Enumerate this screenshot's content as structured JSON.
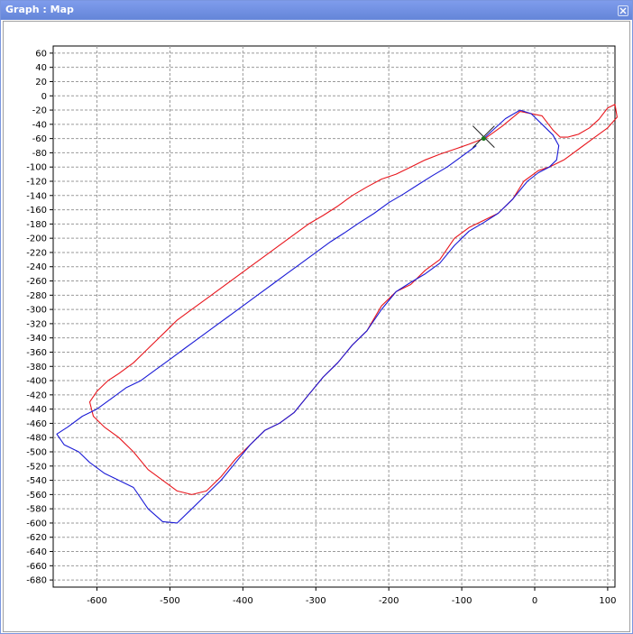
{
  "window": {
    "title": "Graph : Map",
    "close_icon": "close-icon"
  },
  "colors": {
    "red_series": "#e8161d",
    "blue_series": "#1b1bd6",
    "grid": "#9a9a9a",
    "marker": "#1a7a1a"
  },
  "chart_data": {
    "type": "line",
    "grid": true,
    "xlim": [
      -660,
      110
    ],
    "ylim": [
      -690,
      70
    ],
    "x_ticks": [
      -600,
      -500,
      -400,
      -300,
      -200,
      -100,
      0,
      100
    ],
    "y_ticks": [
      60,
      40,
      20,
      0,
      -20,
      -40,
      -60,
      -80,
      -100,
      -120,
      -140,
      -160,
      -180,
      -200,
      -220,
      -240,
      -260,
      -280,
      -300,
      -320,
      -340,
      -360,
      -380,
      -400,
      -420,
      -440,
      -460,
      -480,
      -500,
      -520,
      -540,
      -560,
      -580,
      -600,
      -620,
      -640,
      -660,
      -680
    ],
    "marker": {
      "x": -70,
      "y": -60,
      "shape": "cross"
    },
    "series": [
      {
        "color": "#e8161d",
        "x": [
          -68,
          -45,
          -20,
          10,
          25,
          35,
          45,
          60,
          75,
          88,
          100,
          110,
          113,
          100,
          80,
          60,
          40,
          20,
          5,
          -15,
          -30,
          -50,
          -70,
          -90,
          -110,
          -130,
          -150,
          -170,
          -190,
          -210,
          -230,
          -250,
          -270,
          -290,
          -310,
          -330,
          -350,
          -370,
          -390,
          -410,
          -430,
          -450,
          -470,
          -490,
          -510,
          -530,
          -550,
          -570,
          -590,
          -605,
          -610,
          -600,
          -585,
          -570,
          -550,
          -535,
          -520,
          -505,
          -490,
          -470,
          -450,
          -430,
          -410,
          -390,
          -370,
          -350,
          -330,
          -310,
          -290,
          -270,
          -250,
          -230,
          -210,
          -190,
          -170,
          -150,
          -130,
          -110,
          -90,
          -70
        ],
        "y": [
          -60,
          -43,
          -22,
          -28,
          -48,
          -58,
          -58,
          -54,
          -45,
          -33,
          -17,
          -12,
          -30,
          -45,
          -60,
          -75,
          -90,
          -100,
          -105,
          -120,
          -145,
          -165,
          -175,
          -185,
          -200,
          -230,
          -245,
          -265,
          -275,
          -295,
          -330,
          -350,
          -375,
          -395,
          -420,
          -445,
          -460,
          -470,
          -490,
          -510,
          -535,
          -555,
          -560,
          -555,
          -540,
          -525,
          -500,
          -480,
          -465,
          -450,
          -430,
          -415,
          -400,
          -390,
          -375,
          -360,
          -345,
          -330,
          -315,
          -300,
          -285,
          -270,
          -255,
          -240,
          -225,
          -210,
          -195,
          -180,
          -168,
          -155,
          -140,
          -128,
          -117,
          -110,
          -100,
          -90,
          -82,
          -75,
          -68,
          -60
        ]
      },
      {
        "color": "#1b1bd6",
        "x": [
          -70,
          -40,
          -20,
          -5,
          10,
          25,
          33,
          30,
          20,
          5,
          -10,
          -30,
          -50,
          -70,
          -90,
          -110,
          -130,
          -150,
          -170,
          -190,
          -210,
          -230,
          -250,
          -270,
          -290,
          -310,
          -330,
          -350,
          -370,
          -390,
          -410,
          -430,
          -450,
          -470,
          -490,
          -510,
          -530,
          -550,
          -570,
          -590,
          -610,
          -625,
          -645,
          -655,
          -640,
          -620,
          -600,
          -580,
          -560,
          -540,
          -520,
          -500,
          -480,
          -460,
          -440,
          -420,
          -400,
          -380,
          -360,
          -340,
          -320,
          -300,
          -280,
          -260,
          -240,
          -220,
          -200,
          -180,
          -160,
          -140,
          -120,
          -100,
          -80
        ],
        "y": [
          -60,
          -32,
          -20,
          -25,
          -40,
          -55,
          -70,
          -90,
          -100,
          -108,
          -120,
          -145,
          -165,
          -178,
          -190,
          -210,
          -235,
          -250,
          -262,
          -275,
          -300,
          -330,
          -350,
          -375,
          -395,
          -420,
          -445,
          -460,
          -470,
          -490,
          -515,
          -540,
          -560,
          -580,
          -600,
          -598,
          -580,
          -550,
          -540,
          -530,
          -515,
          -500,
          -490,
          -475,
          -465,
          -450,
          -440,
          -425,
          -410,
          -400,
          -385,
          -370,
          -355,
          -340,
          -325,
          -310,
          -295,
          -280,
          -265,
          -250,
          -235,
          -220,
          -205,
          -192,
          -178,
          -165,
          -150,
          -138,
          -125,
          -112,
          -100,
          -85,
          -70
        ]
      }
    ]
  }
}
